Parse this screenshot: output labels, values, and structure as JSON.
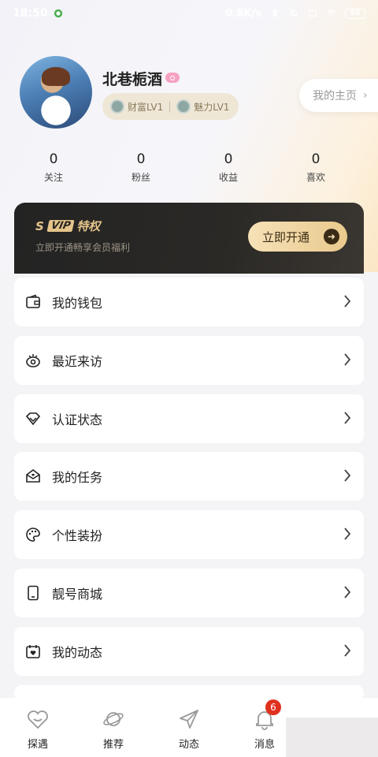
{
  "status_bar": {
    "time": "18:50",
    "network_speed": "0.8K/s",
    "battery": "50",
    "icons": [
      "app-notification-icon",
      "bluetooth-icon",
      "mute-icon",
      "sim-icon",
      "wifi-icon",
      "battery-icon"
    ]
  },
  "profile": {
    "username": "北巷栀酒",
    "badge_icon": "search-badge-icon",
    "wealth_level": "财富LV1",
    "charm_level": "魅力LV1",
    "homepage_label": "我的主页"
  },
  "stats": [
    {
      "value": "0",
      "label": "关注"
    },
    {
      "value": "0",
      "label": "粉丝"
    },
    {
      "value": "0",
      "label": "收益"
    },
    {
      "value": "0",
      "label": "喜欢"
    }
  ],
  "vip": {
    "logo_s": "S",
    "logo_vip": "VIP",
    "title": "特权",
    "subtitle": "立即开通畅享会员福利",
    "button_label": "立即开通"
  },
  "menu": [
    {
      "label": "我的钱包",
      "icon": "wallet-icon"
    },
    {
      "label": "最近来访",
      "icon": "eye-icon"
    },
    {
      "label": "认证状态",
      "icon": "diamond-icon"
    },
    {
      "label": "我的任务",
      "icon": "task-mail-icon"
    },
    {
      "label": "个性装扮",
      "icon": "palette-icon"
    },
    {
      "label": "靓号商城",
      "icon": "phone-icon"
    },
    {
      "label": "我的动态",
      "icon": "calendar-heart-icon"
    }
  ],
  "tabs": [
    {
      "label": "探遇",
      "icon": "heart-icon"
    },
    {
      "label": "推荐",
      "icon": "planet-icon"
    },
    {
      "label": "动态",
      "icon": "paper-plane-icon"
    },
    {
      "label": "消息",
      "icon": "bell-icon"
    }
  ],
  "message_badge": "6",
  "colors": {
    "vip_gold": "#e4c48a",
    "vip_dark": "#232323",
    "badge_red": "#e0301e",
    "page_bg": "#f4f4f6"
  }
}
